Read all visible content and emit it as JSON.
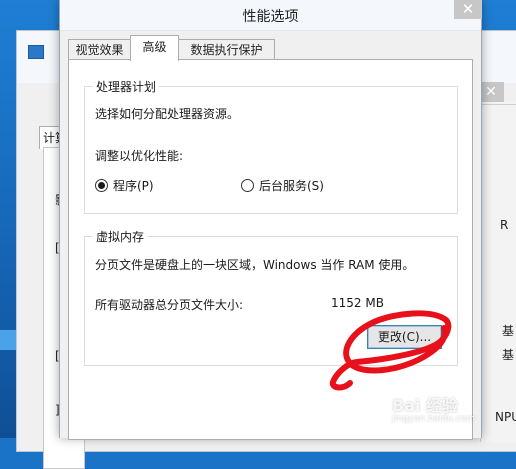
{
  "dialog": {
    "title": "性能选项",
    "close_glyph": "✕",
    "tabs": [
      {
        "label": "视觉效果",
        "active": false
      },
      {
        "label": "高级",
        "active": true
      },
      {
        "label": "数据执行保护",
        "active": false
      }
    ]
  },
  "processor": {
    "group_label": "处理器计划",
    "description": "选择如何分配处理器资源。",
    "optimize_label": "调整以优化性能:",
    "options": [
      {
        "label": "程序(P)",
        "selected": true
      },
      {
        "label": "后台服务(S)",
        "selected": false
      }
    ]
  },
  "virtual_memory": {
    "group_label": "虚拟内存",
    "description": "分页文件是硬盘上的一块区域，Windows 当作 RAM 使用。",
    "total_label": "所有驱动器总分页文件大小:",
    "total_value": "1152 MB",
    "change_button": "更改(C)..."
  },
  "background": {
    "tab_label": "计算",
    "left_chars": [
      "影",
      "[",
      "[",
      "]"
    ],
    "right_chars": [
      "R",
      "基",
      "基",
      "NPU"
    ],
    "close_glyph": "✕"
  },
  "annotation": {
    "ink_color": "#e8101a"
  },
  "watermark": {
    "text": "Bai 经验",
    "sub": "jingyan.baidu.com"
  }
}
